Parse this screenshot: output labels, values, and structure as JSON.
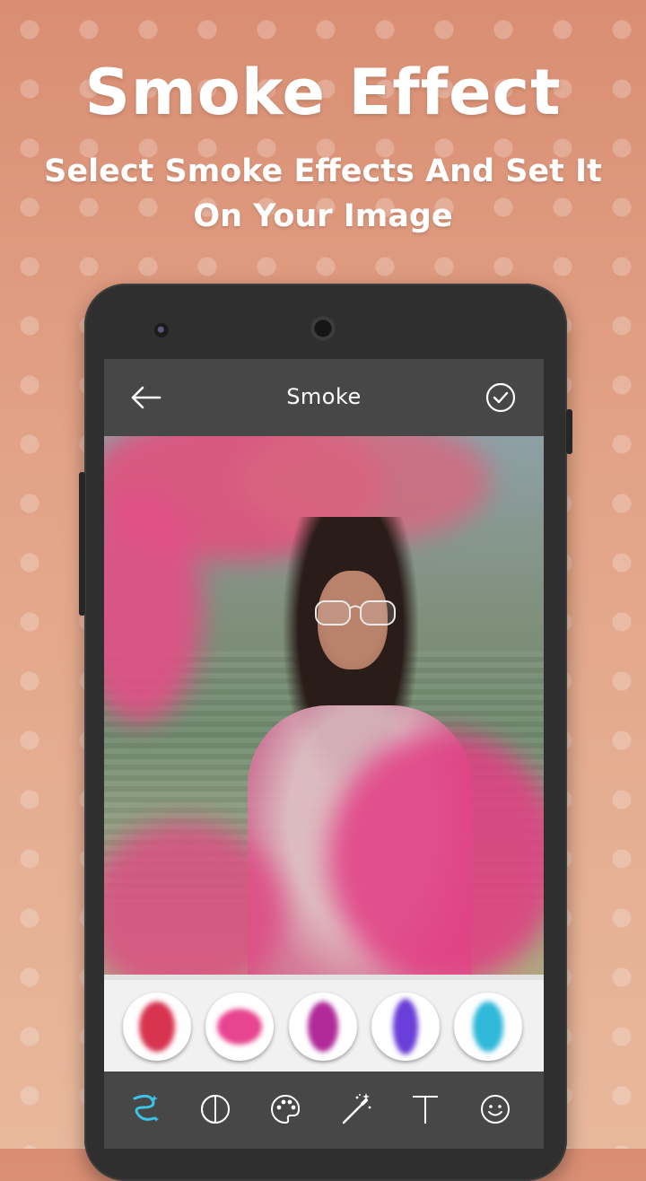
{
  "promo": {
    "headline": "Smoke Effect",
    "subline": "Select Smoke Effects And Set It On Your Image"
  },
  "app": {
    "title": "Smoke",
    "accent_color": "#39c5e8",
    "toolbar_color": "#474747"
  },
  "icons": {
    "back": "back-arrow-icon",
    "confirm": "check-circle-icon"
  },
  "smoke_effects": [
    {
      "name": "smoke-effect-1",
      "color": "#d8334f"
    },
    {
      "name": "smoke-effect-2",
      "color": "#e8458f"
    },
    {
      "name": "smoke-effect-3",
      "color": "#b02a9a"
    },
    {
      "name": "smoke-effect-4",
      "color": "#6a3ed8"
    },
    {
      "name": "smoke-effect-5",
      "color": "#2fb8d8"
    }
  ],
  "tools": [
    {
      "name": "smoke-tool",
      "icon": "smoke-icon",
      "active": true
    },
    {
      "name": "filter-tool",
      "icon": "half-circle-icon",
      "active": false
    },
    {
      "name": "color-tool",
      "icon": "palette-icon",
      "active": false
    },
    {
      "name": "effect-tool",
      "icon": "magic-wand-icon",
      "active": false
    },
    {
      "name": "text-tool",
      "icon": "text-icon",
      "active": false
    },
    {
      "name": "sticker-tool",
      "icon": "smiley-icon",
      "active": false
    }
  ]
}
